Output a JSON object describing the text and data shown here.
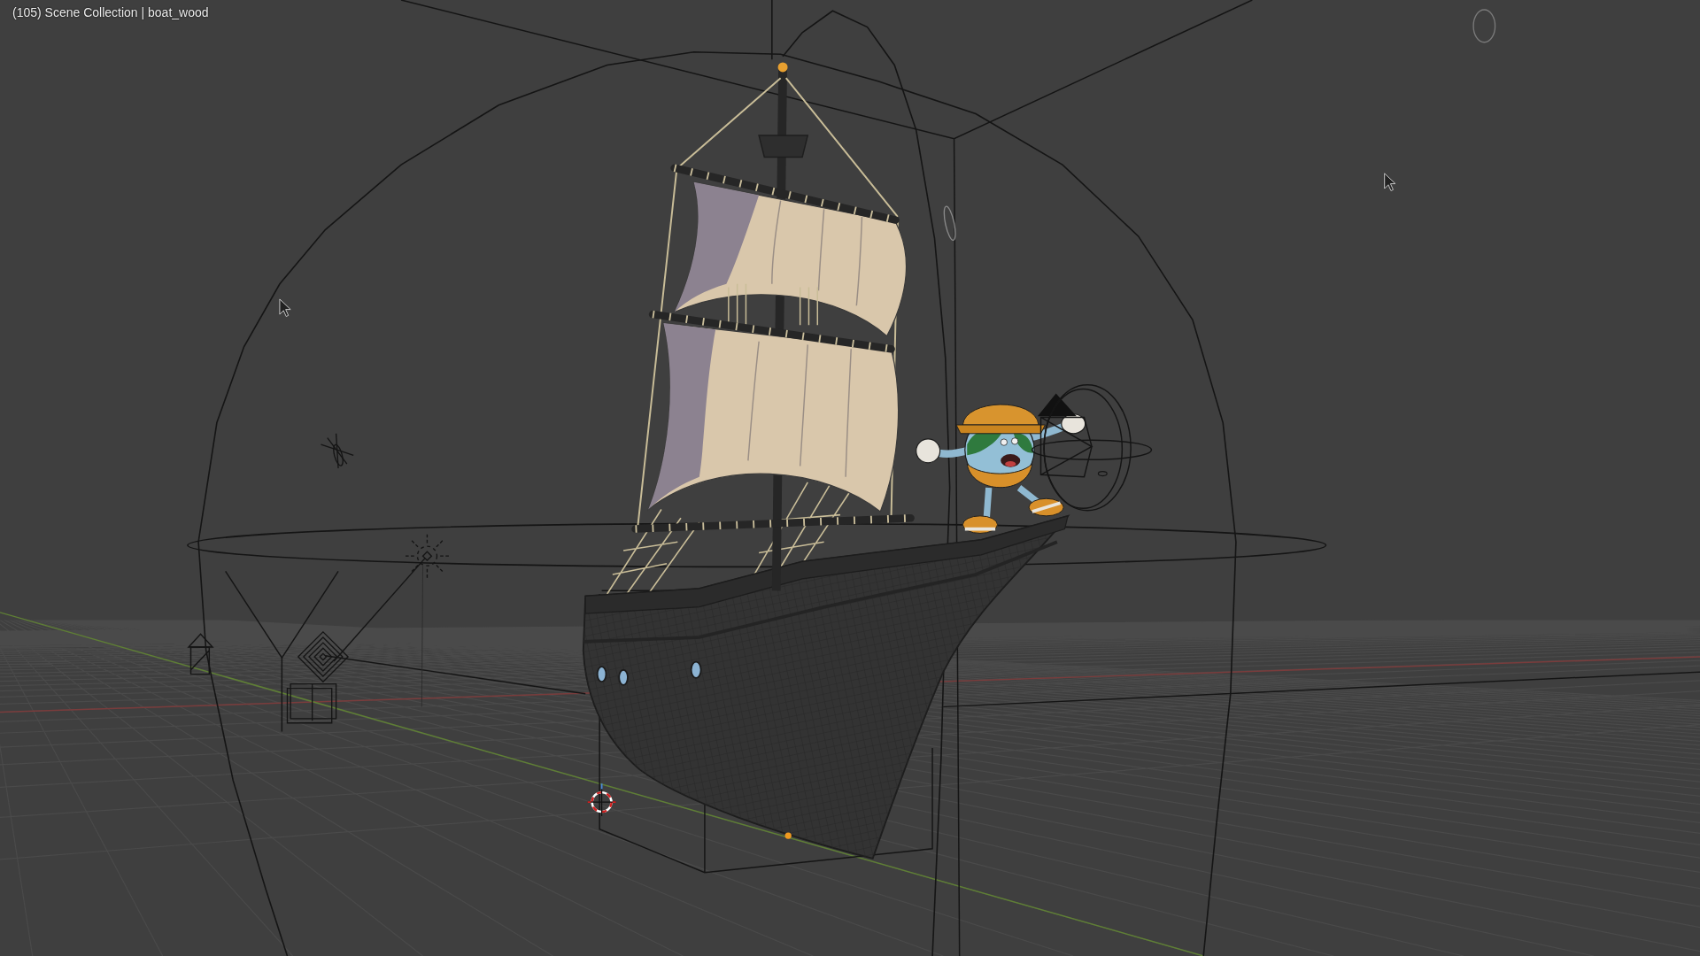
{
  "viewport": {
    "info_text": "(105) Scene Collection | boat_wood"
  }
}
